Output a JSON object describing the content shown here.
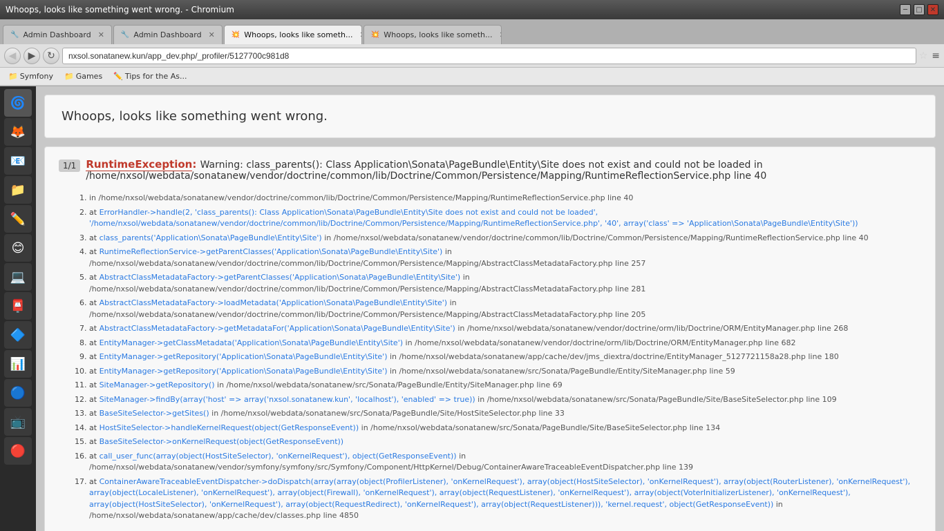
{
  "window": {
    "title": "Whoops, looks like something went wrong. - Chromium"
  },
  "tabs": [
    {
      "id": "tab1",
      "label": "Admin Dashboard",
      "favicon": "🔧",
      "active": false
    },
    {
      "id": "tab2",
      "label": "Admin Dashboard",
      "favicon": "🔧",
      "active": false
    },
    {
      "id": "tab3",
      "label": "Whoops, looks like someth...",
      "favicon": "💥",
      "active": true
    },
    {
      "id": "tab4",
      "label": "Whoops, looks like someth...",
      "favicon": "💥",
      "active": false
    }
  ],
  "address_bar": {
    "url": "nxsol.sonatanew.kun/app_dev.php/_profiler/5127700c981d8"
  },
  "bookmarks": [
    {
      "label": "Symfony",
      "icon": "📁"
    },
    {
      "label": "Games",
      "icon": "📁"
    },
    {
      "label": "Tips for the As...",
      "icon": "✏️"
    }
  ],
  "sidebar_icons": [
    {
      "id": "icon1",
      "symbol": "🌀"
    },
    {
      "id": "icon2",
      "symbol": "🦊"
    },
    {
      "id": "icon3",
      "symbol": "📧"
    },
    {
      "id": "icon4",
      "symbol": "📁"
    },
    {
      "id": "icon5",
      "symbol": "✏️"
    },
    {
      "id": "icon6",
      "symbol": "😊"
    },
    {
      "id": "icon7",
      "symbol": "💻"
    },
    {
      "id": "icon8",
      "symbol": "📮"
    },
    {
      "id": "icon9",
      "symbol": "🔷"
    },
    {
      "id": "icon10",
      "symbol": "📊"
    },
    {
      "id": "icon11",
      "symbol": "🔵"
    },
    {
      "id": "icon12",
      "symbol": "📺"
    },
    {
      "id": "icon13",
      "symbol": "🔴"
    }
  ],
  "error_page": {
    "header": "Whoops, looks like something went wrong.",
    "counter": "1/1",
    "exception_class": "RuntimeException",
    "exception_message": "Warning: class_parents(): Class Application\\Sonata\\PageBundle\\Entity\\Site does not exist and could not be loaded in /home/nxsol/webdata/sonatanew/vendor/doctrine/common/lib/Doctrine/Common/Persistence/Mapping/RuntimeReflectionService.php line 40",
    "stack_trace": [
      {
        "num": 1,
        "text": "in /home/nxsol/webdata/sonatanew/vendor/doctrine/common/lib/Doctrine/Common/Persistence/Mapping/RuntimeReflectionService.php line 40"
      },
      {
        "num": 2,
        "link_text": "ErrorHandler->handle(2, 'class_parents(): Class Application\\Sonata\\PageBundle\\Entity\\Site does not exist and could not be loaded', '/home/nxsol/webdata/sonatanew/vendor/doctrine/common/lib/Doctrine/Common/Persistence/Mapping/RuntimeReflectionService.php', '40', array('class' => 'Application\\Sonata\\PageBundle\\Entity\\Site'))",
        "link_href": "#"
      },
      {
        "num": 3,
        "link_text": "class_parents('Application\\Sonata\\PageBundle\\Entity\\Site')",
        "path": "in /home/nxsol/webdata/sonatanew/vendor/doctrine/common/lib/Doctrine/Common/Persistence/Mapping/RuntimeReflectionService.php line 40"
      },
      {
        "num": 4,
        "link_text": "RuntimeReflectionService->getParentClasses('Application\\Sonata\\PageBundle\\Entity\\Site')",
        "path": "in /home/nxsol/webdata/sonatanew/vendor/doctrine/common/lib/Doctrine/Common/Persistence/Mapping/AbstractClassMetadataFactory.php line 257"
      },
      {
        "num": 5,
        "link_text": "AbstractClassMetadataFactory->getParentClasses('Application\\Sonata\\PageBundle\\Entity\\Site')",
        "path": "in /home/nxsol/webdata/sonatanew/vendor/doctrine/common/lib/Doctrine/Common/Persistence/Mapping/AbstractClassMetadataFactory.php line 281"
      },
      {
        "num": 6,
        "link_text": "AbstractClassMetadataFactory->loadMetadata('Application\\Sonata\\PageBundle\\Entity\\Site')",
        "path": "in /home/nxsol/webdata/sonatanew/vendor/doctrine/common/lib/Doctrine/Common/Persistence/Mapping/AbstractClassMetadataFactory.php line 205"
      },
      {
        "num": 7,
        "link_text": "AbstractClassMetadataFactory->getMetadataFor('Application\\Sonata\\PageBundle\\Entity\\Site')",
        "path": "in /home/nxsol/webdata/sonatanew/vendor/doctrine/orm/lib/Doctrine/ORM/EntityManager.php line 268"
      },
      {
        "num": 8,
        "link_text": "EntityManager->getClassMetadata('Application\\Sonata\\PageBundle\\Entity\\Site')",
        "path": "in /home/nxsol/webdata/sonatanew/vendor/doctrine/orm/lib/Doctrine/ORM/EntityManager.php line 682"
      },
      {
        "num": 9,
        "link_text": "EntityManager->getRepository('Application\\Sonata\\PageBundle\\Entity\\Site')",
        "path": "in /home/nxsol/webdata/sonatanew/app/cache/dev/jms_diextra/doctrine/EntityManager_5127721158a28.php line 180"
      },
      {
        "num": 10,
        "link_text": "EntityManager->getRepository('Application\\Sonata\\PageBundle\\Entity\\Site')",
        "path": "in /home/nxsol/webdata/sonatanew/src/Sonata/PageBundle/Entity/SiteManager.php line 59"
      },
      {
        "num": 11,
        "link_text": "SiteManager->getRepository()",
        "path": "in /home/nxsol/webdata/sonatanew/src/Sonata/PageBundle/Entity/SiteManager.php line 69"
      },
      {
        "num": 12,
        "link_text": "SiteManager->findBy(array('host' => array('nxsol.sonatanew.kun', 'localhost'), 'enabled' => true))",
        "path": "in /home/nxsol/webdata/sonatanew/src/Sonata/PageBundle/Site/BaseSiteSelector.php line 109"
      },
      {
        "num": 13,
        "link_text": "BaseSiteSelector->getSites()",
        "path": "in /home/nxsol/webdata/sonatanew/src/Sonata/PageBundle/Site/HostSiteSelector.php line 33"
      },
      {
        "num": 14,
        "link_text": "HostSiteSelector->handleKernelRequest(object(GetResponseEvent))",
        "path": "in /home/nxsol/webdata/sonatanew/src/Sonata/PageBundle/Site/BaseSiteSelector.php line 134"
      },
      {
        "num": 15,
        "link_text": "BaseSiteSelector->onKernelRequest(object(GetResponseEvent))",
        "path": ""
      },
      {
        "num": 16,
        "link_text": "call_user_func(array(object(HostSiteSelector), 'onKernelRequest'), object(GetResponseEvent))",
        "path": "in /home/nxsol/webdata/sonatanew/vendor/symfony/symfony/src/Symfony/Component/HttpKernel/Debug/ContainerAwareTraceableEventDispatcher.php line 139"
      },
      {
        "num": 17,
        "link_text": "ContainerAwareTraceableEventDispatcher->doDispatch(array(array(object(ProfilerListener), 'onKernelRequest'), array(object(HostSiteSelector), 'onKernelRequest'), array(object(RouterListener), 'onKernelRequest'), array(object(LocaleListener), 'onKernelRequest'), array(object(Firewall), 'onKernelRequest'), array(object(RequestListener), 'onKernelRequest'), array(object(VoterInitializerListener), 'onKernelRequest'), array(object(HostSiteSelector), 'onKernelRequest'), array(object(RequestRedirect), 'onKernelRequest'), array(object(RequestListener))), 'kernel.request', object(GetResponseEvent))",
        "path": "in /home/nxsol/webdata/sonatanew/app/cache/dev/classes.php line 4850"
      }
    ]
  }
}
